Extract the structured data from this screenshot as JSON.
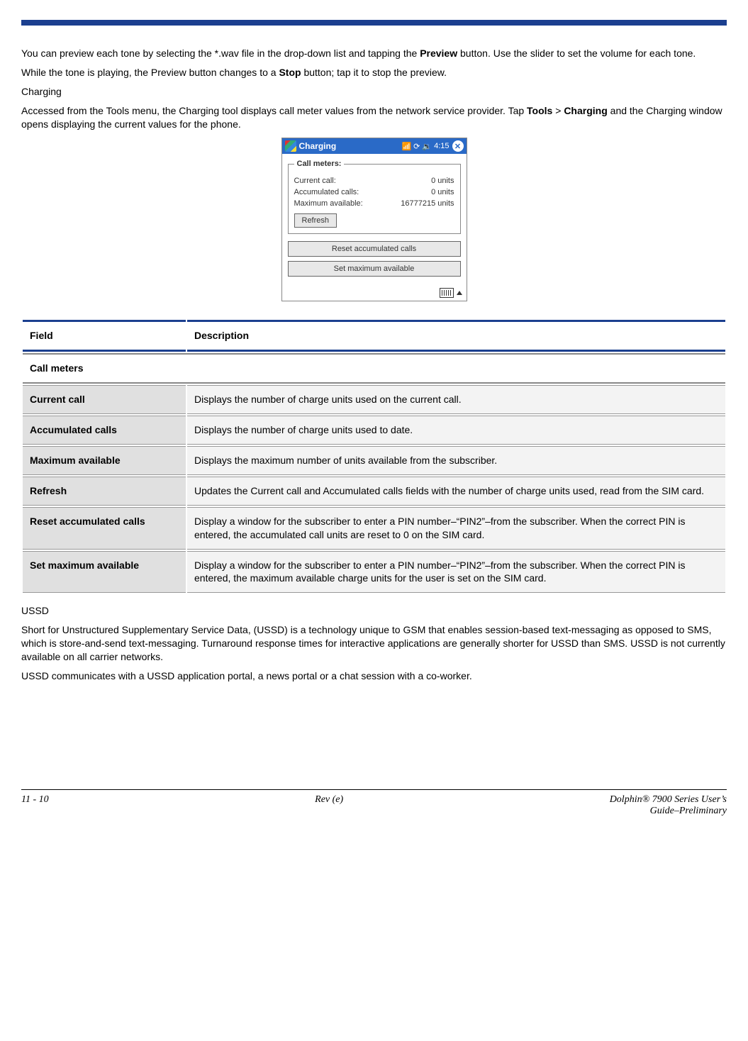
{
  "intro": {
    "p1_a": "You can preview each tone by selecting the *.wav file in the drop-down list and tapping the ",
    "p1_preview": "Preview",
    "p1_b": " button. Use the slider to set the volume for each tone.",
    "p2_a": "While the tone is playing, the Preview button changes to a ",
    "p2_stop": "Stop",
    "p2_b": " button; tap it to stop the preview.",
    "charging_heading": "Charging",
    "p3_a": "Accessed from the Tools menu, the Charging tool displays call meter values from the network service provider. Tap ",
    "p3_tools": "Tools",
    "p3_gt": " > ",
    "p3_charging": "Charging",
    "p3_b": " and the Charging window opens displaying the current values for the phone."
  },
  "screenshot": {
    "title": "Charging",
    "time": "4:15",
    "legend": "Call meters:",
    "rows": {
      "current_label": "Current call:",
      "current_value": "0 units",
      "accum_label": "Accumulated calls:",
      "accum_value": "0 units",
      "max_label": "Maximum available:",
      "max_value": "16777215 units"
    },
    "refresh": "Refresh",
    "reset": "Reset accumulated calls",
    "setmax": "Set maximum available"
  },
  "table": {
    "head_field": "Field",
    "head_desc": "Description",
    "section": "Call meters",
    "rows": [
      {
        "field": "Current call",
        "desc": "Displays the number of charge units used on the current call."
      },
      {
        "field": "Accumulated calls",
        "desc": "Displays the number of charge units used to date."
      },
      {
        "field": "Maximum available",
        "desc": "Displays the maximum number of units available from the subscriber."
      },
      {
        "field": "Refresh",
        "desc": "Updates the Current call and Accumulated calls fields with the number of charge units used, read from the SIM card."
      },
      {
        "field": "Reset accumulated calls",
        "desc": "Display a window for the subscriber to enter a PIN number–“PIN2”–from the subscriber. When the correct PIN is entered, the accumulated call units are reset to 0 on the SIM card."
      },
      {
        "field": "Set maximum available",
        "desc": "Display a window for the subscriber to enter a PIN number–“PIN2”–from the subscriber. When the correct PIN is entered, the maximum available charge units for the user is set on the SIM card."
      }
    ]
  },
  "ussd": {
    "heading": "USSD",
    "p1": "Short for Unstructured Supplementary Service Data, (USSD) is a technology unique to GSM that enables session-based text-messaging as opposed to SMS, which is store-and-send text-messaging. Turnaround response times for interactive applications are generally shorter for USSD than SMS. USSD is not currently available on all carrier networks.",
    "p2": "USSD communicates with a USSD application portal, a news portal or a chat session with a co-worker."
  },
  "footer": {
    "left": "11 - 10",
    "center": "Rev (e)",
    "right1": "Dolphin® 7900 Series User’s",
    "right2": "Guide–Preliminary"
  }
}
